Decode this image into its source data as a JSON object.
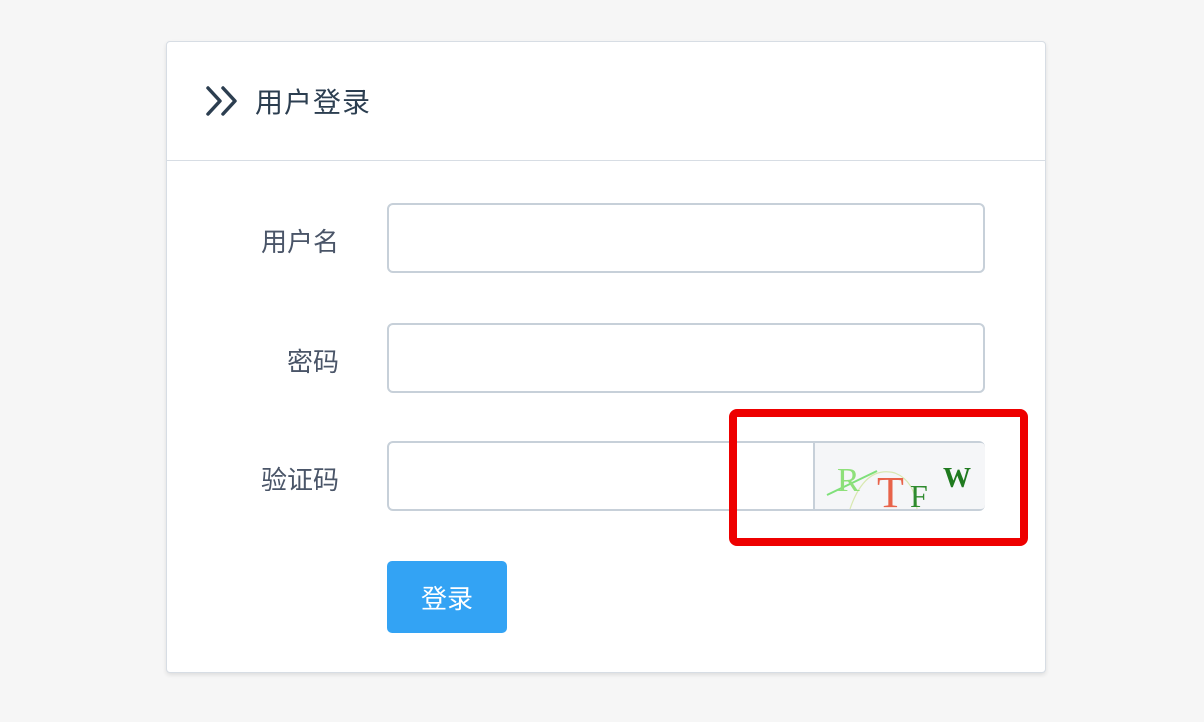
{
  "card": {
    "title": "用户登录",
    "title_icon": "double-chevron-right-icon"
  },
  "form": {
    "username": {
      "label": "用户名",
      "value": "",
      "placeholder": ""
    },
    "password": {
      "label": "密码",
      "value": "",
      "placeholder": ""
    },
    "captcha": {
      "label": "验证码",
      "value": "",
      "placeholder": "",
      "image_text": [
        "R",
        "T",
        "F",
        "W"
      ],
      "image_colors": [
        "#8ee07a",
        "#e8634a",
        "#2e8b2e",
        "#1f7a1f"
      ]
    },
    "submit_label": "登录"
  },
  "colors": {
    "accent": "#33a3f4",
    "highlight": "#ee0000",
    "text": "#2c3e50"
  }
}
